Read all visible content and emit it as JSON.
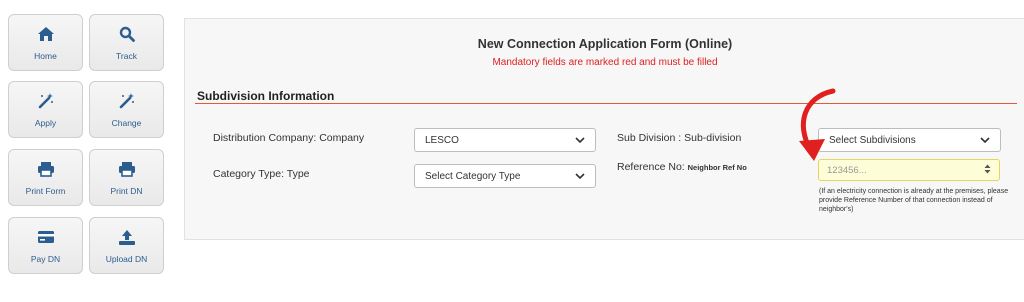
{
  "sidebar": {
    "home": "Home",
    "track": "Track",
    "apply": "Apply",
    "change": "Change",
    "print_form": "Print Form",
    "print_dn": "Print DN",
    "pay_dn": "Pay DN",
    "upload_dn": "Upload DN"
  },
  "form": {
    "title": "New Connection Application Form (Online)",
    "subtitle": "Mandatory fields are marked red and must be filled",
    "section_title": "Subdivision Information",
    "distribution_label": "Distribution Company: Company",
    "distribution_value": "LESCO",
    "category_label": "Category Type:   Type",
    "category_value": "Select Category Type",
    "subdivision_label": "Sub Division : Sub-division",
    "subdivision_value": "Select Subdivisions",
    "reference_label": "Reference No:",
    "reference_label_small": "Neighbor Ref No",
    "reference_placeholder": "123456...",
    "reference_note": "(If an electricity connection is already at the premises, please provide Reference Number of that connection instead of neighbor's)"
  },
  "colors": {
    "icon": "#2c5d8f",
    "mandatory": "#e02020",
    "section_line": "#e05a3c",
    "arrow": "#e0201e",
    "ref_input_bg": "#fdfdd8"
  },
  "icons": [
    "home-icon",
    "search-icon",
    "magic-wand-icon",
    "printer-icon",
    "credit-card-icon",
    "upload-icon",
    "chevron-down-icon",
    "spinner-arrows-icon",
    "curved-arrow-icon"
  ]
}
